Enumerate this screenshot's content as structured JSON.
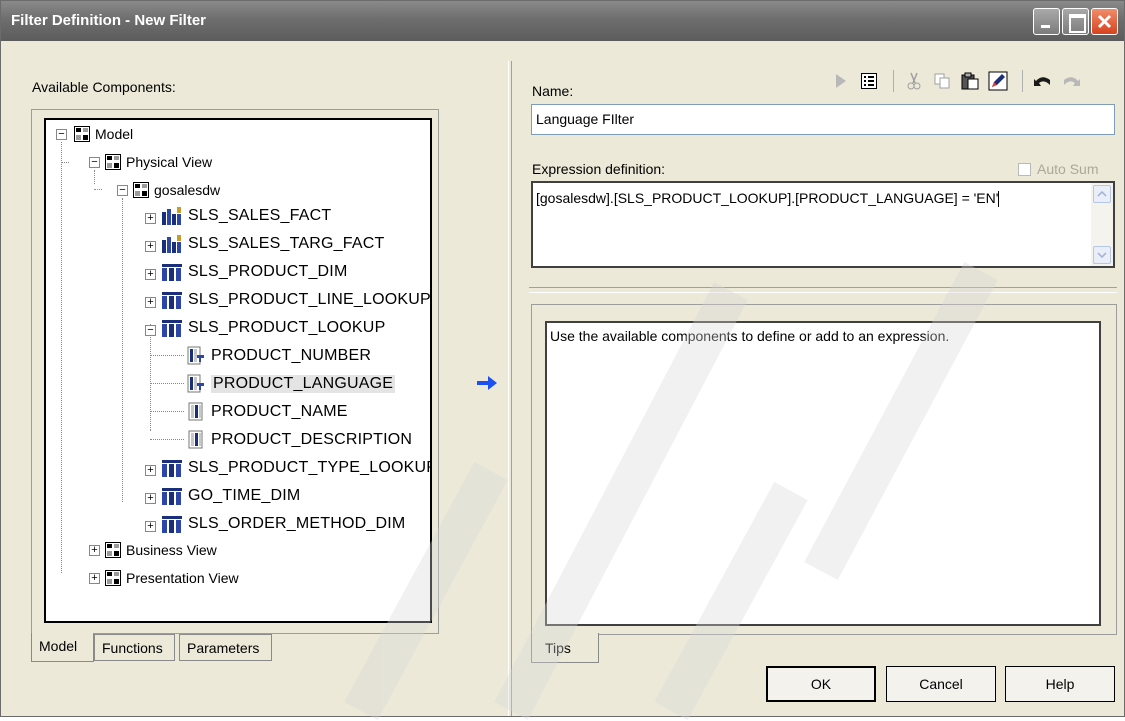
{
  "window": {
    "title": "Filter Definition - New Filter"
  },
  "left": {
    "available_label": "Available Components:",
    "tree": {
      "model": "Model",
      "physical_view": "Physical View",
      "gosalesdw": "gosalesdw",
      "tables": [
        "SLS_SALES_FACT",
        "SLS_SALES_TARG_FACT",
        "SLS_PRODUCT_DIM",
        "SLS_PRODUCT_LINE_LOOKUP",
        "SLS_PRODUCT_LOOKUP"
      ],
      "columns": [
        "PRODUCT_NUMBER",
        "PRODUCT_LANGUAGE",
        "PRODUCT_NAME",
        "PRODUCT_DESCRIPTION"
      ],
      "tables_after": [
        "SLS_PRODUCT_TYPE_LOOKUP",
        "GO_TIME_DIM",
        "SLS_ORDER_METHOD_DIM"
      ],
      "business_view": "Business View",
      "presentation_view": "Presentation View"
    },
    "tabs": [
      "Model",
      "Functions",
      "Parameters"
    ]
  },
  "right": {
    "name_label": "Name:",
    "name_value": "Language FIlter",
    "expr_label": "Expression definition:",
    "auto_sum_label": "Auto Sum",
    "expression": "[gosalesdw].[SLS_PRODUCT_LOOKUP].[PRODUCT_LANGUAGE]  = 'EN'",
    "tips_text": "Use the available components to define or add to an expression.",
    "tips_tab": "Tips"
  },
  "toolbar": {
    "icons": [
      "run-icon",
      "properties-icon",
      "cut-icon",
      "copy-icon",
      "paste-icon",
      "edit-icon",
      "undo-icon",
      "redo-icon"
    ]
  },
  "buttons": {
    "ok": "OK",
    "cancel": "Cancel",
    "help": "Help"
  },
  "colors": {
    "titlebar": "#6e6e6e",
    "window_bg": "#ece9d8",
    "arrow": "#1c50f0",
    "close_button": "#d6431e"
  }
}
